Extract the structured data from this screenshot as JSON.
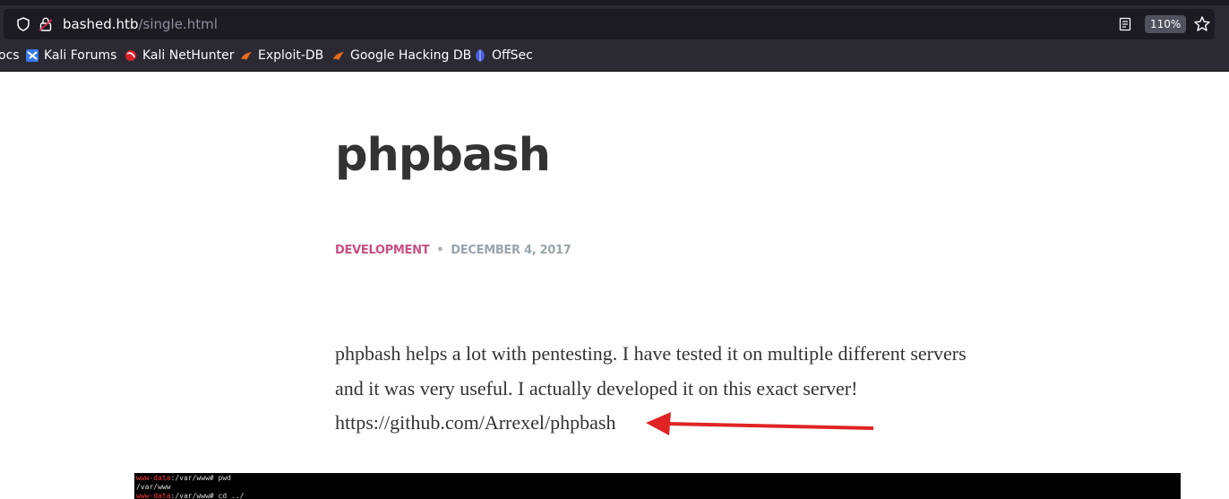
{
  "browser": {
    "url_host": "bashed.htb",
    "url_path": "/single.html",
    "zoom": "110%",
    "bookmarks": [
      {
        "label": "ocs",
        "icon": "partial-bookmark"
      },
      {
        "label": "Kali Forums",
        "icon": "kali-forums-icon"
      },
      {
        "label": "Kali NetHunter",
        "icon": "kali-nethunter-icon"
      },
      {
        "label": "Exploit-DB",
        "icon": "exploit-db-icon"
      },
      {
        "label": "Google Hacking DB",
        "icon": "ghdb-icon"
      },
      {
        "label": "OffSec",
        "icon": "offsec-icon"
      }
    ]
  },
  "post": {
    "title": "phpbash",
    "category": "DEVELOPMENT",
    "separator": "•",
    "date": "DECEMBER 4, 2017",
    "body_lines": [
      "phpbash helps a lot with pentesting. I have tested it on multiple different servers",
      "and it was very useful. I actually developed it on this exact server!",
      "https://github.com/Arrexel/phpbash"
    ]
  },
  "terminal": {
    "lines": [
      {
        "user": "www-data",
        "rest": ":/var/www# pwd"
      },
      {
        "user": "",
        "rest": "/var/www"
      },
      {
        "user": "www-data",
        "rest": ":/var/www# cd ../"
      }
    ]
  },
  "colors": {
    "category": "#c94f85",
    "date": "#9aa5ab",
    "arrow": "#e02424",
    "browser_chrome": "#2b2a33"
  }
}
